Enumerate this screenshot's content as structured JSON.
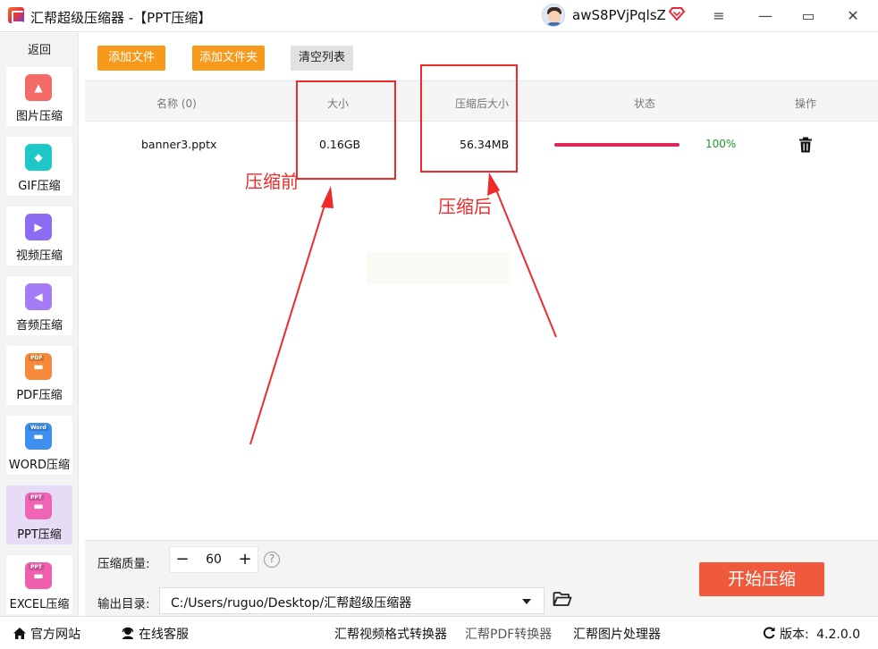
{
  "titlebar": {
    "app_title": "汇帮超级压缩器   -【PPT压缩】",
    "username": "awS8PVjPqlsZ",
    "menu_glyph": "≡",
    "minimize_glyph": "—",
    "maximize_glyph": "▭",
    "close_glyph": "✕"
  },
  "sidebar": {
    "back_label": "返回",
    "items": [
      {
        "label": "图片压缩",
        "icon": "image-icon",
        "color": "#f46a66"
      },
      {
        "label": "GIF压缩",
        "icon": "gif-icon",
        "color": "#1fc8c8"
      },
      {
        "label": "视频压缩",
        "icon": "video-icon",
        "color": "#8b6cf2"
      },
      {
        "label": "音频压缩",
        "icon": "audio-icon",
        "color": "#a47cf5"
      },
      {
        "label": "PDF压缩",
        "icon": "pdf-icon",
        "color": "#f58a3a",
        "tag": "PDF"
      },
      {
        "label": "WORD压缩",
        "icon": "word-icon",
        "color": "#3f8ff0",
        "tag": "Word"
      },
      {
        "label": "PPT压缩",
        "icon": "ppt-icon",
        "color": "#f064b4",
        "tag": "PPT"
      },
      {
        "label": "EXCEL压缩",
        "icon": "excel-icon",
        "color": "#ef5fae",
        "tag": "PPT"
      }
    ]
  },
  "toolbar": {
    "add_file_label": "添加文件",
    "add_folder_label": "添加文件夹",
    "clear_list_label": "清空列表"
  },
  "table": {
    "headers": {
      "name": "名称 (0)",
      "size": "大小",
      "compressed_size": "压缩后大小",
      "status": "状态",
      "action": "操作"
    },
    "rows": [
      {
        "name": "banner3.pptx",
        "size": "0.16GB",
        "compressed_size": "56.34MB",
        "progress_percent": 100,
        "progress_label": "100%"
      }
    ]
  },
  "annotations": {
    "before_label": "压缩前",
    "after_label": "压缩后",
    "color": "#ee2a2a"
  },
  "settings": {
    "quality_label": "压缩质量:",
    "quality_value": "60",
    "minus_glyph": "−",
    "plus_glyph": "+",
    "help_glyph": "?",
    "output_label": "输出目录:",
    "output_path": "C:/Users/ruguo/Desktop/汇帮超级压缩器",
    "start_label": "开始压缩"
  },
  "statusbar": {
    "website_label": "官方网站",
    "support_label": "在线客服",
    "link_video": "汇帮视频格式转换器",
    "link_pdf": "汇帮PDF转换器",
    "link_image": "汇帮图片处理器",
    "version_label": "版本:",
    "version_value": "4.2.0.0"
  }
}
